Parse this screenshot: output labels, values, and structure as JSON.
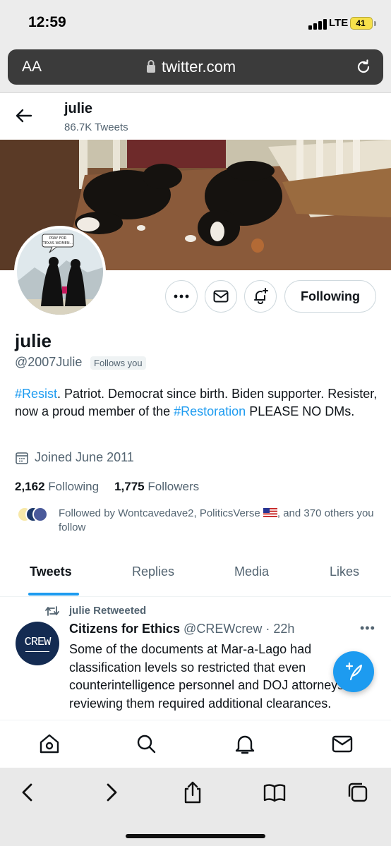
{
  "status_bar": {
    "time": "12:59",
    "network": "LTE",
    "battery": "41"
  },
  "url_bar": {
    "text_size_label": "AA",
    "domain": "twitter.com"
  },
  "header": {
    "name": "julie",
    "tweet_count": "86.7K Tweets"
  },
  "profile": {
    "display_name": "julie",
    "handle": "@2007Julie",
    "follows_you": "Follows you",
    "following_button": "Following",
    "bio_tag1": "#Resist",
    "bio_part1": ". Patriot. Democrat since birth. Biden supporter. Resister, now a proud member of the ",
    "bio_tag2": "#Restoration",
    "bio_part2": " PLEASE NO DMs.",
    "joined": "Joined June 2011",
    "following_count": "2,162",
    "following_label": "Following",
    "followers_count": "1,775",
    "followers_label": "Followers",
    "followed_by_prefix": "Followed by Wontcavedave2, PoliticsVerse ",
    "followed_by_suffix": ", and 370 others you follow",
    "avatar_sign": "PRAY FOR TEXAS WOMEN..."
  },
  "tabs": [
    "Tweets",
    "Replies",
    "Media",
    "Likes"
  ],
  "tweet": {
    "retweeted_by": "julie Retweeted",
    "author_name": "Citizens for Ethics",
    "author_handle": "@CREWcrew",
    "time": "· 22h",
    "avatar_text": "CREW",
    "text": "Some of the documents at Mar-a-Lago had classification levels so restricted that even counterintelligence personnel and DOJ attorneys reviewing them required additional clearances."
  },
  "colors": {
    "accent": "#1d9bf0",
    "text": "#0f1419",
    "muted": "#536471"
  },
  "icons": {
    "bottom_nav": [
      "home-icon",
      "search-icon",
      "bell-icon",
      "mail-icon"
    ],
    "safari": [
      "back-icon",
      "forward-icon",
      "share-icon",
      "bookmarks-icon",
      "tabs-icon"
    ]
  }
}
